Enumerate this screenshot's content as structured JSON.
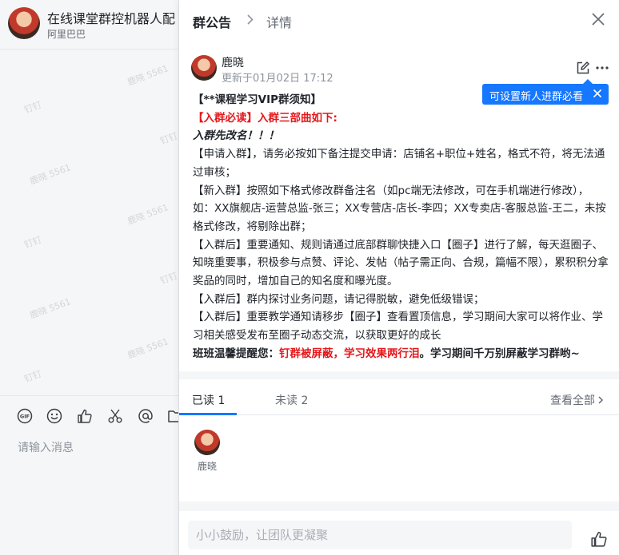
{
  "chat": {
    "title": "在线课堂群控机器人配",
    "subtitle": "阿里巴巴",
    "watermarks": [
      "鹿晓 5561",
      "钉钉",
      "鹿晓 5561",
      "钉钉",
      "鹿晓 5561",
      "钉钉",
      "鹿晓 5561",
      "钉钉",
      "鹿晓 5561",
      "钉钉"
    ],
    "toolbar_icons": [
      "gif-icon",
      "emoji-icon",
      "thumbs-up-icon",
      "scissors-icon",
      "at-icon",
      "folder-icon"
    ],
    "input_placeholder": "请输入消息"
  },
  "panel": {
    "title": "群公告",
    "detail": "详情",
    "author": "鹿晓",
    "updated": "更新于01月02日 17:12",
    "tip": "可设置新人进群必看",
    "content": {
      "l1": "【**课程学习VIP群须知】",
      "l2": "【入群必读】入群三部曲如下:",
      "l3": "入群先改名！！！",
      "l4": "【申请入群】，请务必按如下备注提交申请：店铺名+职位+姓名，格式不符，将无法通过审核；",
      "l5": "【新入群】按照如下格式修改群备注名（如pc端无法修改，可在手机端进行修改），如：XX旗舰店-运营总监-张三；XX专营店-店长-李四；XX专卖店-客服总监-王二，未按格式修改，将剔除出群；",
      "l6": "【入群后】重要通知、规则请通过底部群聊快捷入口【圈子】进行了解，每天逛圈子、知晓重要事，积极参与点赞、评论、发帖（帖子需正向、合规，篇幅不限），累积积分拿奖品的同时，增加自己的知名度和曝光度。",
      "l7": "【入群后】群内探讨业务问题，请记得脱敏，避免低级错误；",
      "l8": "【入群后】重要教学通知请移步【圈子】查看置顶信息，学习期间大家可以将作业、学习相关感受发布至圈子动态交流，以获取更好的成长",
      "l9a": "班班温馨提醒您：",
      "l9b": "钉群被屏蔽，学习效果两行泪",
      "l9c": "。学习期间千万别屏蔽学习群哟~"
    },
    "tab_read": "已读 1",
    "tab_unread": "未读 2",
    "view_all": "查看全部",
    "reader_name": "鹿晓",
    "comment_placeholder": "小小鼓励，让团队更凝聚"
  },
  "colors": {
    "accent": "#1677ff",
    "warning_red": "#e5171b"
  }
}
